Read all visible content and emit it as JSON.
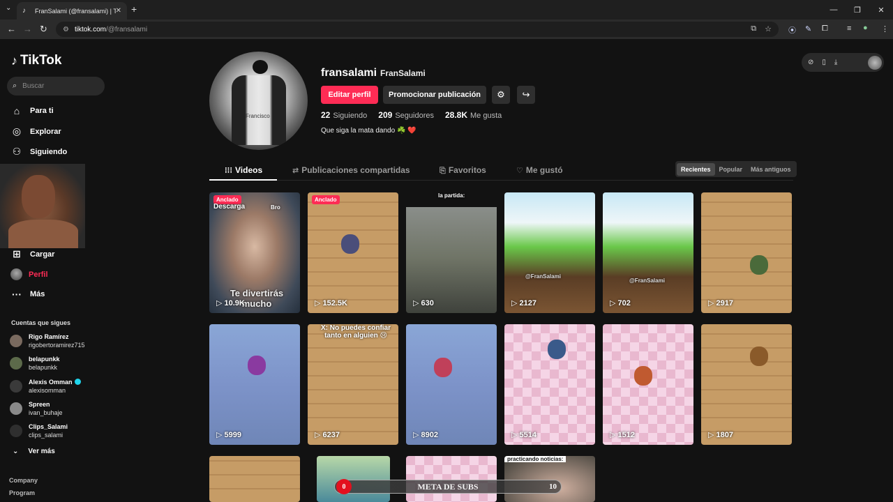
{
  "browser": {
    "tab_title": "FranSalami (@fransalami) | TikT",
    "url_host": "tiktok.com",
    "url_path": "/@fransalami"
  },
  "sidebar": {
    "logo": "TikTok",
    "search_placeholder": "Buscar",
    "nav": [
      {
        "label": "Para ti",
        "icon": "home-icon"
      },
      {
        "label": "Explorar",
        "icon": "compass-icon"
      },
      {
        "label": "Siguiendo",
        "icon": "following-icon"
      },
      {
        "label": "Cargar",
        "icon": "upload-icon"
      },
      {
        "label": "Perfil",
        "icon": "profile-icon"
      },
      {
        "label": "Más",
        "icon": "more-icon"
      }
    ],
    "following_title": "Cuentas que sigues",
    "following": [
      {
        "name": "Rigo Ramírez",
        "handle": "rigobertoramirez715",
        "verified": false
      },
      {
        "name": "belapunkk",
        "handle": "belapunkk",
        "verified": false
      },
      {
        "name": "Alexis Omman",
        "handle": "alexisomman",
        "verified": true
      },
      {
        "name": "Spreen",
        "handle": "ivan_buhaje",
        "verified": false
      },
      {
        "name": "Clips_Salami",
        "handle": "clips_salami",
        "verified": false
      }
    ],
    "see_more": "Ver más",
    "footer": [
      "Company",
      "Program"
    ]
  },
  "profile": {
    "username": "fransalami",
    "display_name": "FranSalami",
    "edit_label": "Editar perfil",
    "promote_label": "Promocionar publicación",
    "avatar_caption": "Francisco",
    "stats": [
      {
        "value": "22",
        "label": "Siguiendo"
      },
      {
        "value": "209",
        "label": "Seguidores"
      },
      {
        "value": "28.8K",
        "label": "Me gusta"
      }
    ],
    "bio": "Que siga la mata dando ☘️ ❤️"
  },
  "tabs": [
    {
      "label": "Videos",
      "icon": "grid-icon"
    },
    {
      "label": "Publicaciones compartidas",
      "icon": "repost-icon"
    },
    {
      "label": "Favoritos",
      "icon": "bookmark-icon"
    },
    {
      "label": "Me gustó",
      "icon": "heart-icon"
    }
  ],
  "sort": [
    "Recientes",
    "Popular",
    "Más antiguos"
  ],
  "videos": [
    {
      "views": "10.9K",
      "pinned": "Anclado",
      "text_top": "Descarga",
      "text_tag": "Bro",
      "text_bottom": "Te divertirás mucho"
    },
    {
      "views": "152.5K",
      "pinned": "Anclado"
    },
    {
      "views": "630",
      "text_top": "la partida:"
    },
    {
      "views": "2127",
      "text_mid": "@FranSalami"
    },
    {
      "views": "702",
      "text_mid": "@FranSalami"
    },
    {
      "views": "2917"
    },
    {
      "views": "5999"
    },
    {
      "views": "6237",
      "text_top": "X: No puedes confiar tanto en alguien 😢"
    },
    {
      "views": "8902"
    },
    {
      "views": "5514"
    },
    {
      "views": "1512"
    },
    {
      "views": "1807"
    },
    {
      "views": ""
    },
    {
      "views": ""
    },
    {
      "views": ""
    },
    {
      "views": "",
      "text_top": "practicando noticias:"
    }
  ],
  "overlay": {
    "current": "0",
    "label": "META DE SUBS",
    "goal": "10"
  }
}
